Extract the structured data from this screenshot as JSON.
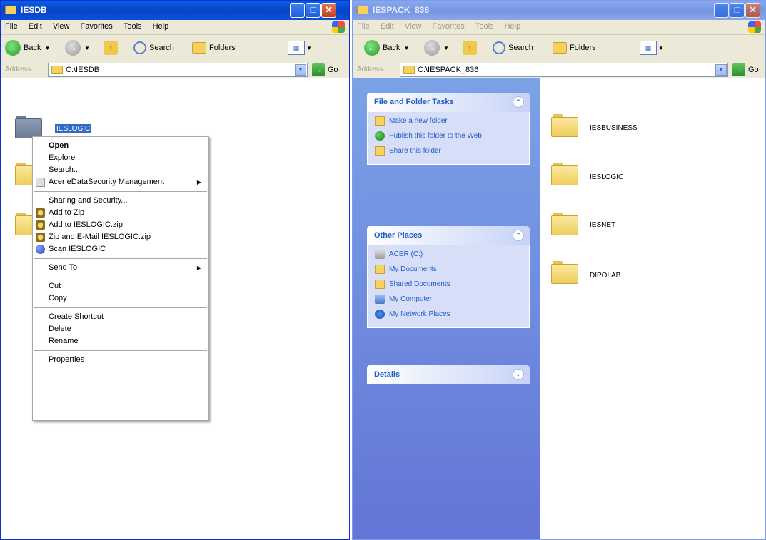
{
  "win1": {
    "title": "IESDB",
    "menu": [
      "File",
      "Edit",
      "View",
      "Favorites",
      "Tools",
      "Help"
    ],
    "toolbar": {
      "back": "Back",
      "search": "Search",
      "folders": "Folders"
    },
    "address_label": "Address",
    "address_value": "C:\\IESDB",
    "go": "Go",
    "selected_folder": "IESLOGIC"
  },
  "context_menu": {
    "items": [
      "Open",
      "Explore",
      "Search...",
      "Acer eDataSecurity Management",
      "Sharing and Security...",
      "Add to Zip",
      "Add to IESLOGIC.zip",
      "Zip and E-Mail IESLOGIC.zip",
      "Scan IESLOGIC",
      "Send To",
      "Cut",
      "Copy",
      "Create Shortcut",
      "Delete",
      "Rename",
      "Properties"
    ]
  },
  "win2": {
    "title": "IESPACK_836",
    "menu": [
      "File",
      "Edit",
      "View",
      "Favorites",
      "Tools",
      "Help"
    ],
    "toolbar": {
      "back": "Back",
      "search": "Search",
      "folders": "Folders"
    },
    "address_label": "Address",
    "address_value": "C:\\IESPACK_836",
    "go": "Go",
    "tasks": {
      "title": "File and Folder Tasks",
      "links": [
        "Make a new folder",
        "Publish this folder to the Web",
        "Share this folder"
      ]
    },
    "other_places": {
      "title": "Other Places",
      "links": [
        "ACER (C:)",
        "My Documents",
        "Shared Documents",
        "My Computer",
        "My Network Places"
      ]
    },
    "details": {
      "title": "Details"
    },
    "folders": [
      "IESBUSINESS",
      "IESLOGIC",
      "IESNET",
      "DIPOLAB"
    ]
  }
}
